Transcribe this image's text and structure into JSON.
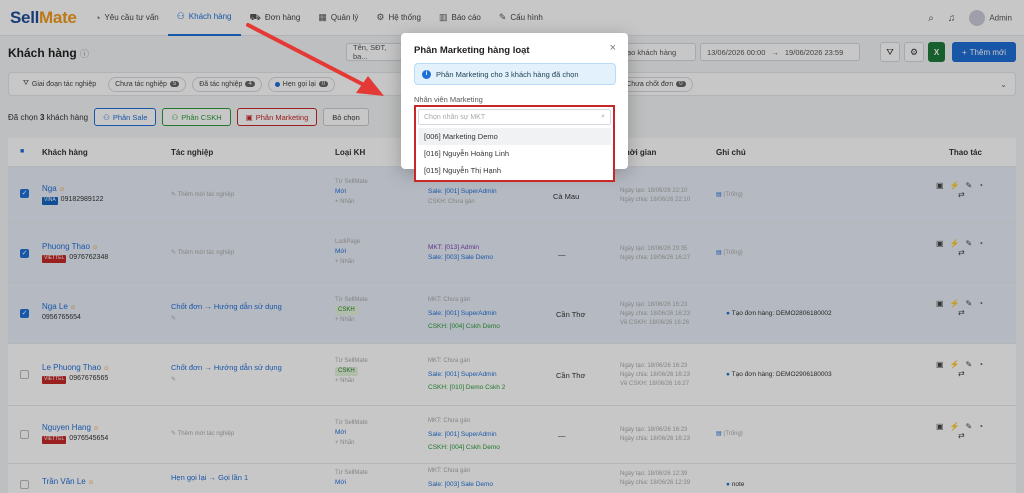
{
  "nav": {
    "logo_a": "Sell",
    "logo_b": "Mate",
    "items": [
      {
        "label": "Yêu cầu tư vấn",
        "icon": "chat-icon"
      },
      {
        "label": "Khách hàng",
        "icon": "users-icon"
      },
      {
        "label": "Đơn hàng",
        "icon": "cart-icon"
      },
      {
        "label": "Quản lý",
        "icon": "grid-icon"
      },
      {
        "label": "Hệ thống",
        "icon": "gear-icon"
      },
      {
        "label": "Báo cáo",
        "icon": "chart-icon"
      },
      {
        "label": "Cấu hình",
        "icon": "wrench-icon"
      }
    ],
    "user": "Admin"
  },
  "page": {
    "title": "Khách hàng",
    "search_placeholder": "Tên, SĐT, ba...",
    "date_type": "ạo khách hàng",
    "date_from": "13/06/2026 00:00",
    "date_sep": "→",
    "date_to": "19/06/2026 23:59",
    "add_label": "Thêm mới"
  },
  "filters": [
    {
      "label": "Giai đoạn tác nghiệp",
      "count": ""
    },
    {
      "label": "Chưa tác nghiệp",
      "count": "5"
    },
    {
      "label": "Đã tác nghiệp",
      "count": "4"
    },
    {
      "label": "Hẹn gọi lại",
      "count": "0"
    },
    {
      "label": "Chưa chốt đơn",
      "count": "0"
    }
  ],
  "selection": {
    "prefix": "Đã chọn",
    "count": "3",
    "suffix": "khách hàng",
    "btn_sale": "Phân Sale",
    "btn_cskh": "Phân CSKH",
    "btn_mkt": "Phân Marketing",
    "btn_clear": "Bỏ chọn"
  },
  "table": {
    "headers": [
      "Khách hàng",
      "Tác nghiệp",
      "Loại KH",
      "Thời gian",
      "Ghi chú",
      "Thao tác"
    ],
    "rows": [
      {
        "name": "Nga",
        "carrier": "VINA",
        "phone": "09182989122",
        "task": "Thêm mới tác nghiệp",
        "source": "Từ SellMate",
        "type": "Mới",
        "add": "+ Nhãn",
        "mkt": "",
        "sale": "Sale: [001] SuperAdmin",
        "cskh": "CSKH: Chưa gán",
        "loc": "Cà Mau",
        "t1": "Ngày tạo: 18/06/26 22:10",
        "t2": "Ngày chia: 18/06/26 22:10",
        "t3": "",
        "note": "(Trống)",
        "selected": true
      },
      {
        "name": "Phuong Thao",
        "carrier": "VIETTEL",
        "phone": "0976762348",
        "task": "Thêm mới tác nghiệp",
        "source": "LadiPage",
        "type": "Mới",
        "add": "+ Nhãn",
        "mkt": "MKT: [013] Admin",
        "sale": "Sale: [003] Sale Demo",
        "cskh": "",
        "loc": "—",
        "t1": "Ngày tạo: 18/06/26 20:35",
        "t2": "Ngày chia: 19/06/26 16:27",
        "t3": "",
        "note": "(Trống)",
        "selected": true
      },
      {
        "name": "Nga Le",
        "carrier": "",
        "phone": "0956765654",
        "task": "Chốt đơn → Hướng dẫn sử dụng",
        "source": "Từ SellMate",
        "type": "CSKH",
        "add": "+ Nhãn",
        "mkt": "MKT: Chưa gán",
        "sale": "Sale: [001] SuperAdmin",
        "cskh": "CSKH: [004] Cskh Demo",
        "loc": "Cần Thơ",
        "t1": "Ngày tạo: 18/06/26 16:23",
        "t2": "Ngày chia: 18/06/26 16:23",
        "t3": "Về CSKH: 18/06/26 16:26",
        "note": "Tạo đơn hàng: DEMO2806180002",
        "selected": true
      },
      {
        "name": "Le Phuong Thao",
        "carrier": "VIETTEL",
        "phone": "0967676565",
        "task": "Chốt đơn → Hướng dẫn sử dụng",
        "source": "Từ SellMate",
        "type": "CSKH",
        "add": "+ Nhãn",
        "mkt": "MKT: Chưa gán",
        "sale": "Sale: [001] SuperAdmin",
        "cskh": "CSKH: [010] Demo Cskh 2",
        "loc": "Cần Thơ",
        "t1": "Ngày tạo: 18/06/26 16:23",
        "t2": "Ngày chia: 18/06/26 16:23",
        "t3": "Về CSKH: 18/06/26 16:27",
        "note": "Tạo đơn hàng: DEMO2906180003",
        "selected": false
      },
      {
        "name": "Nguyen Hang",
        "carrier": "VIETTEL",
        "phone": "0976545654",
        "task": "Thêm mới tác nghiệp",
        "source": "Từ SellMate",
        "type": "Mới",
        "add": "+ Nhãn",
        "mkt": "MKT: Chưa gán",
        "sale": "Sale: [001] SuperAdmin",
        "cskh": "CSKH: [004] Cskh Demo",
        "loc": "—",
        "t1": "Ngày tạo: 18/06/26 16:23",
        "t2": "Ngày chia: 18/06/26 16:23",
        "t3": "",
        "note": "(Trống)",
        "selected": false
      },
      {
        "name": "Trần Văn Le",
        "carrier": "",
        "phone": "",
        "task": "Hẹn gọi lại → Gọi lần 1",
        "source": "Từ SellMate",
        "type": "Mới",
        "add": "",
        "mkt": "MKT: Chưa gán",
        "sale": "Sale: [003] Sale Demo",
        "cskh": "",
        "loc": "",
        "t1": "Ngày tạo: 18/06/26 12:39",
        "t2": "Ngày chia: 18/06/26 12:39",
        "t3": "",
        "note": "note",
        "selected": false
      }
    ]
  },
  "modal": {
    "title": "Phân Marketing hàng loạt",
    "close": "×",
    "info": "Phân Marketing cho 3 khách hàng đã chọn",
    "field_label": "Nhân viên Marketing",
    "placeholder": "Chọn nhân sự MKT",
    "options": [
      "[006] Marketing Demo",
      "[016] Nguyễn Hoàng Linh",
      "[015] Nguyễn Thị Hạnh"
    ]
  },
  "colors": {
    "primary": "#1f6fd8",
    "highlight_border": "#c62828",
    "arrow": "#e53935"
  }
}
